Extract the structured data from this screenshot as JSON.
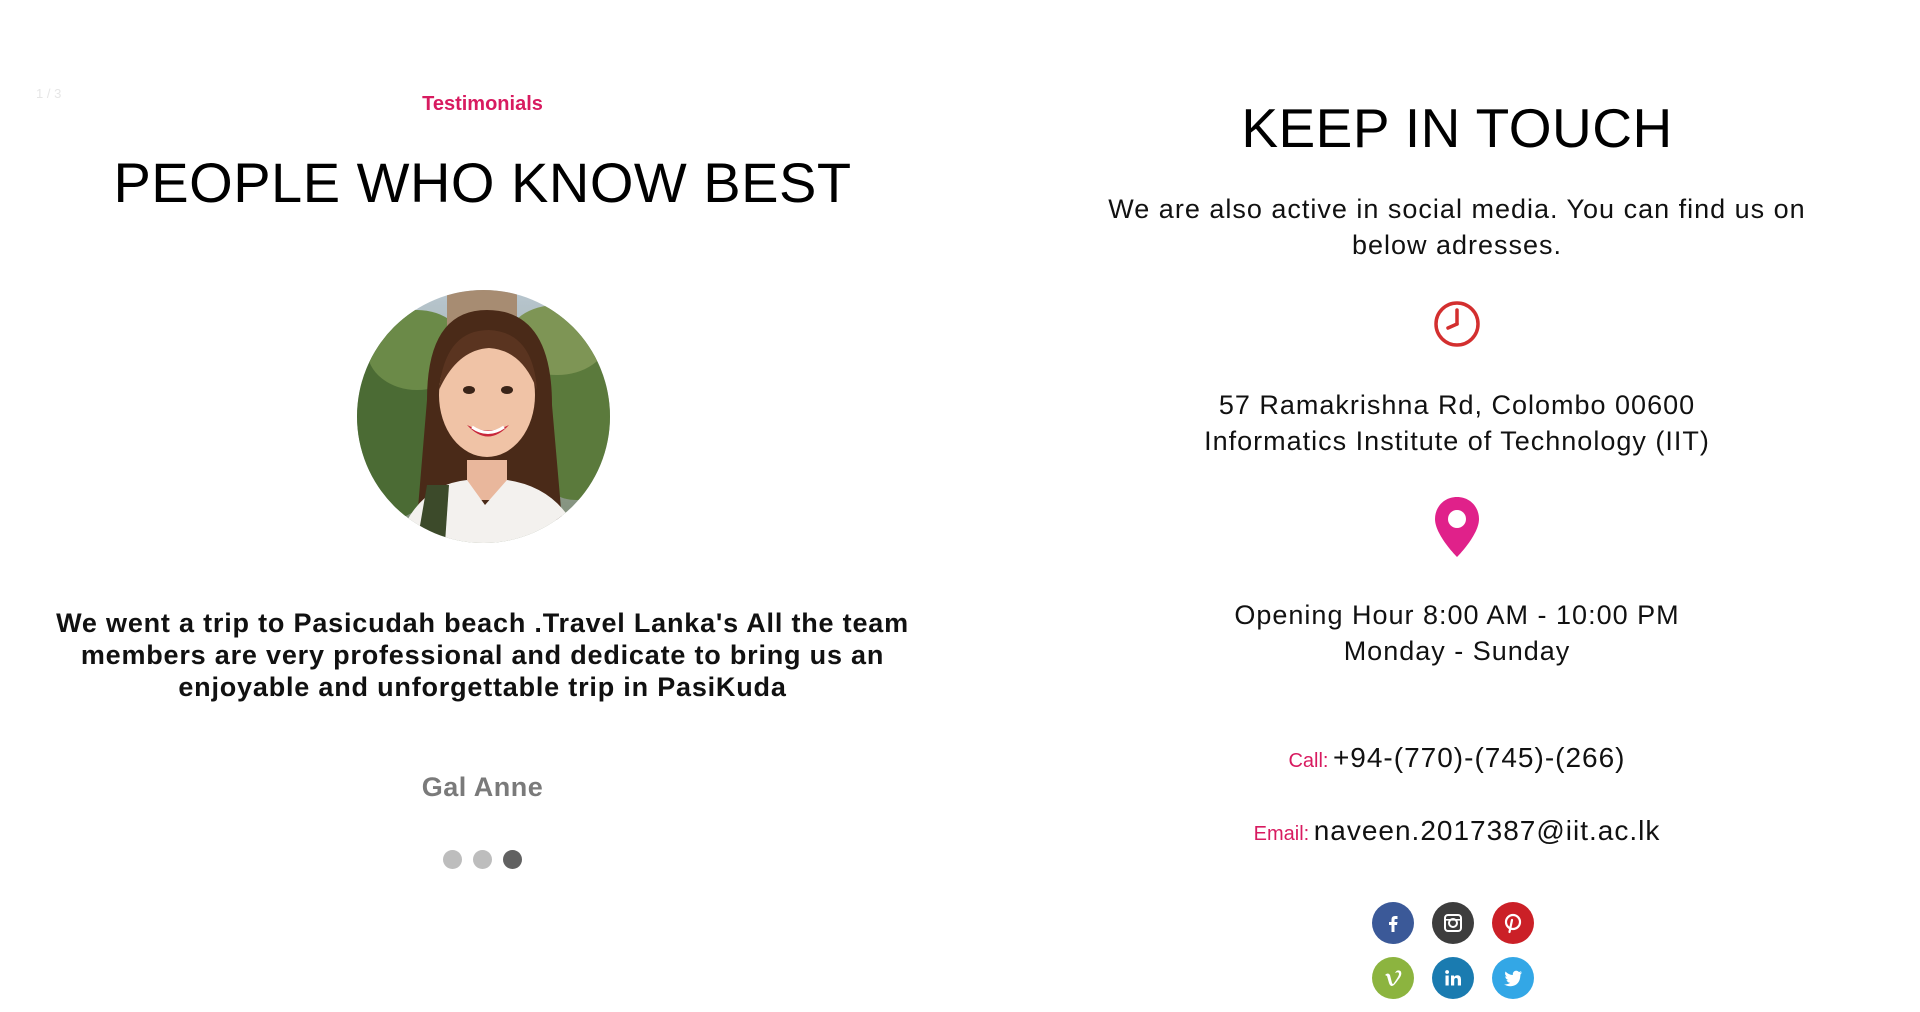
{
  "testimonials": {
    "slide_counter": "1 / 3",
    "eyebrow": "Testimonials",
    "title": "PEOPLE WHO KNOW BEST",
    "quote": "We went a trip to Pasicudah beach .Travel Lanka's All the team members are very professional and dedicate to bring us an enjoyable and unforgettable trip in PasiKuda",
    "author": "Gal Anne",
    "slides_total": 3,
    "active_slide": 3
  },
  "contact": {
    "title": "KEEP IN TOUCH",
    "intro": "We are also active in social media. You can find us on below adresses.",
    "address_line1": "57 Ramakrishna Rd, Colombo 00600",
    "address_line2": "Informatics Institute of Technology (IIT)",
    "hours_line1": "Opening Hour 8:00 AM - 10:00 PM",
    "hours_line2": "Monday - Sunday",
    "call_label": "Call:",
    "call_value": "+94-(770)-(745)-(266)",
    "email_label": "Email:",
    "email_value": "naveen.2017387@iit.ac.lk",
    "icons": {
      "hours": "clock-icon",
      "location": "map-pin-icon"
    },
    "socials": [
      {
        "name": "facebook-icon",
        "color": "#3b5998"
      },
      {
        "name": "instagram-icon",
        "color": "#3d3d3d"
      },
      {
        "name": "pinterest-icon",
        "color": "#cb2027"
      },
      {
        "name": "vimeo-icon",
        "color": "#8cb43f"
      },
      {
        "name": "linkedin-icon",
        "color": "#1a7bb0"
      },
      {
        "name": "twitter-icon",
        "color": "#33a7e6"
      }
    ]
  },
  "colors": {
    "accent": "#d81b60",
    "clock_icon": "#d32f2f",
    "pin_icon": "#e0218a",
    "author": "#7a7a7a",
    "dot_inactive": "#bdbdbd",
    "dot_active": "#616161"
  }
}
